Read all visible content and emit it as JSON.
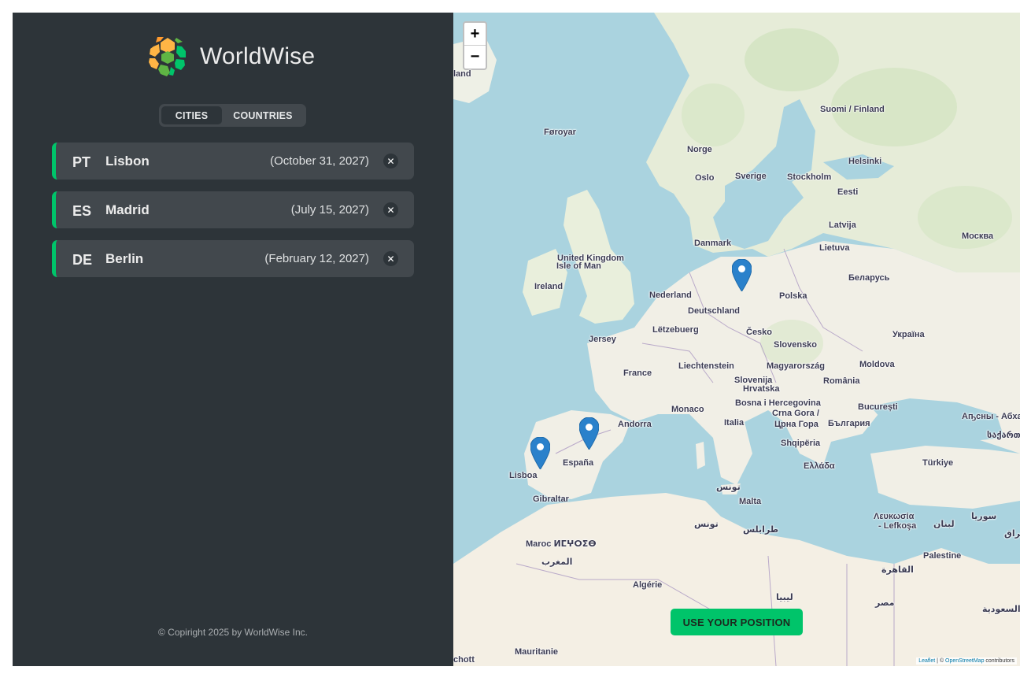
{
  "app": {
    "name": "WorldWise"
  },
  "tabs": [
    {
      "label": "CITIES",
      "active": true
    },
    {
      "label": "COUNTRIES",
      "active": false
    }
  ],
  "cities": [
    {
      "code": "PT",
      "name": "Lisbon",
      "date": "(October 31, 2027)"
    },
    {
      "code": "ES",
      "name": "Madrid",
      "date": "(July 15, 2027)"
    },
    {
      "code": "DE",
      "name": "Berlin",
      "date": "(February 12, 2027)"
    }
  ],
  "footer": {
    "copyright": "© Copiright 2025 by WorldWise Inc."
  },
  "map": {
    "zoom_in": "+",
    "zoom_out": "−",
    "use_position": "USE YOUR POSITION",
    "attribution_leaflet": "Leaflet",
    "attribution_sep": " | © ",
    "attribution_osm": "OpenStreetMap",
    "attribution_tail": " contributors",
    "labels": {
      "iceland": "land",
      "faroe": "Føroyar",
      "norway": "Norge",
      "oslo": "Oslo",
      "sweden": "Sverige",
      "stockholm": "Stockholm",
      "finland": "Suomi / Finland",
      "helsinki": "Helsinki",
      "estonia": "Eesti",
      "latvia": "Latvija",
      "lithuania": "Lietuva",
      "moscow": "Москва",
      "denmark": "Danmark",
      "uk": "United Kingdom",
      "isle_of_man": "Isle of Man",
      "ireland": "Ireland",
      "netherlands": "Nederland",
      "germany": "Deutschland",
      "poland": "Polska",
      "belarus": "Беларусь",
      "luxembourg": "Lëtzebuerg",
      "cesko": "Česko",
      "ukraine": "Україна",
      "jersey": "Jersey",
      "slovakia": "Slovensko",
      "france": "France",
      "liechtenstein": "Liechtenstein",
      "hungary": "Magyarország",
      "moldova": "Moldova",
      "slovenia": "Slovenija",
      "croatia": "Hrvatska",
      "romania": "România",
      "bosnia": "Bosna i Hercegovina",
      "montenegro": "Crna Gora /",
      "montenegro2": "Црна Гора",
      "bulgaria": "България",
      "bucharest": "București",
      "abkhazia": "Аҧсны - Абхазі",
      "georgia": "საქართ",
      "monaco": "Monaco",
      "andorra": "Andorra",
      "italy": "Italia",
      "albania": "Shqipëria",
      "greece": "Ελλάδα",
      "turkey": "Türkiye",
      "spain": "España",
      "lisboa": "Lisboa",
      "gibraltar": "Gibraltar",
      "tunis": "تونس",
      "malta": "Malta",
      "tunisia": "تونس",
      "tripoli": "طرابلس",
      "cyprus": "Λευκωσία",
      "cyprus2": "- Lefkoşa",
      "lebanon": "لبنان",
      "syria": "سوريا",
      "iraq": "العراق",
      "morocco": "Maroc ⵍⵎⵖⵔⵉⴱ",
      "morocco_ar": "المغرب",
      "palestine": "Palestine",
      "cairo": "القاهرة",
      "algeria": "Algérie",
      "libya": "ليبيا",
      "egypt": "مصر",
      "saudi": "السعودية",
      "mauritania": "Mauritanie",
      "mali": "chott"
    }
  }
}
